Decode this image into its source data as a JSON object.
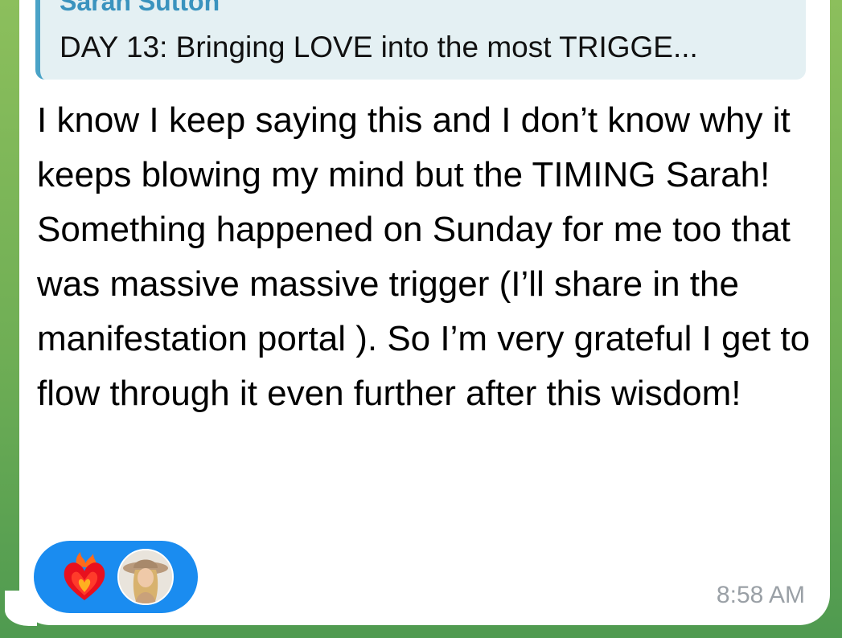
{
  "reply_preview": {
    "sender": "Sarah Sutton",
    "text": "DAY 13: Bringing LOVE into the most TRIGGE..."
  },
  "message": {
    "text": "I know I keep saying this and I don’t know why it keeps blowing my mind but the TIMING Sarah! Something happened on Sunday for me too that was massive massive trigger (I’ll share in the manifestation portal ). So I’m very grateful I get to flow through it even further after this wisdom!",
    "time": "8:58 AM"
  },
  "reactions": {
    "emoji_icon": "heart-on-fire-icon",
    "reactor_avatar": "user-avatar"
  },
  "colors": {
    "accent_name": "#3a93be",
    "reply_bar": "#4aa3c7",
    "reaction_pill": "#1a8cf0",
    "timestamp": "#9aa0a6"
  }
}
